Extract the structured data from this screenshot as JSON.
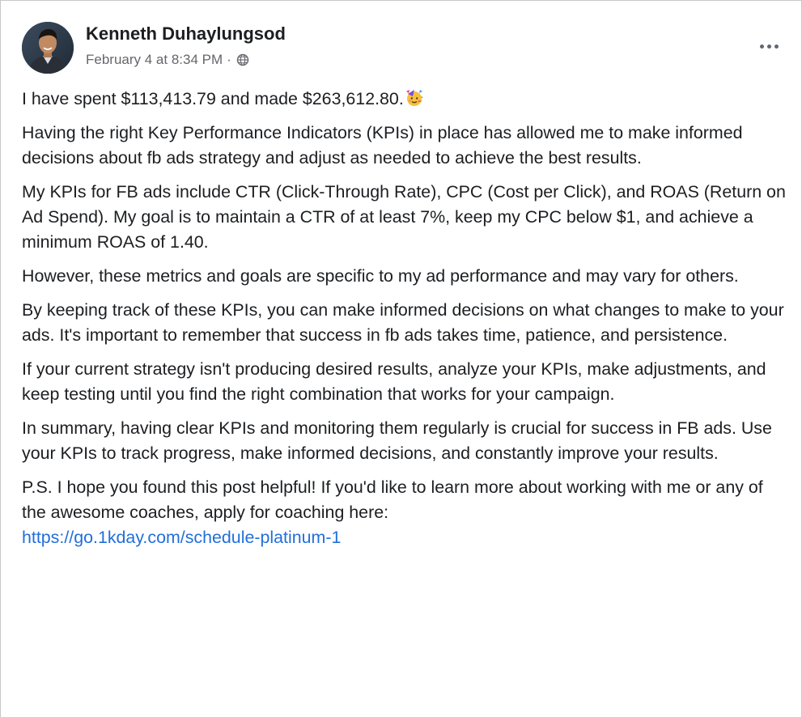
{
  "post": {
    "author": "Kenneth Duhaylungsod",
    "timestamp": "February 4 at 8:34 PM",
    "separator": "·",
    "audience_icon": "globe-icon",
    "more_icon": "more-options-icon",
    "emoji_icon": "party-face-emoji",
    "paragraphs": [
      "I have spent $113,413.79 and made $263,612.80.",
      "Having the right Key Performance Indicators (KPIs) in place has allowed me to make informed decisions about fb ads strategy and adjust as needed to achieve the best results.",
      "My KPIs for FB ads include CTR (Click-Through Rate), CPC (Cost per Click), and ROAS (Return on Ad Spend). My goal is to maintain a CTR of at least 7%, keep my CPC below $1, and achieve a minimum ROAS of 1.40.",
      "However, these metrics and goals are specific to my ad performance and may vary for others.",
      "By keeping track of these KPIs, you can make informed decisions on what changes to make to your ads. It's important to remember that success in fb ads takes time, patience, and persistence.",
      "If your current strategy isn't producing desired results, analyze your KPIs, make adjustments, and keep testing until you find the right combination that works for your campaign.",
      "In summary, having clear KPIs and monitoring them regularly is crucial for success in FB ads. Use your KPIs to track progress, make informed decisions, and constantly improve your results.",
      "P.S. I hope you found this post helpful! If you'd like to learn more about working with me or any of the awesome coaches, apply for coaching here:"
    ],
    "link": "https://go.1kday.com/schedule-platinum-1"
  },
  "colors": {
    "text": "#1c1e21",
    "secondary_text": "#65676b",
    "link": "#216fdb",
    "border": "#c8c8c8"
  }
}
